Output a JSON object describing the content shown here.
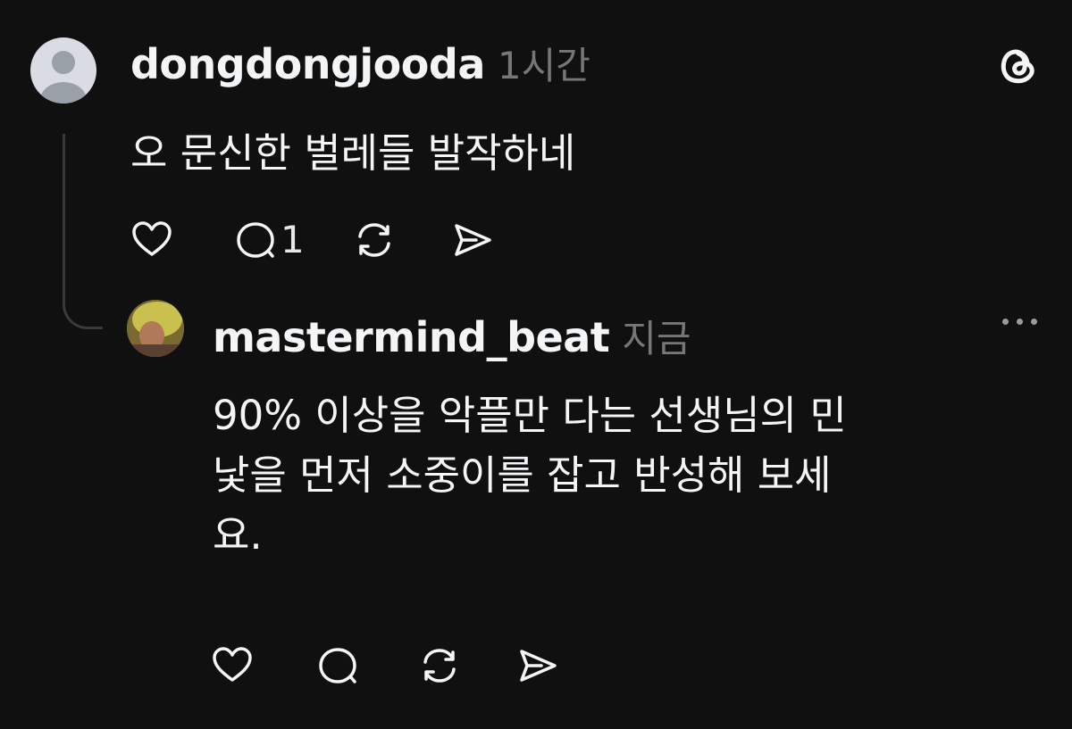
{
  "comment": {
    "username": "dongdongjooda",
    "time": "1시간",
    "text": "오 문신한 벌레들 발작하네",
    "reply_count": "1"
  },
  "reply": {
    "username": "mastermind_beat",
    "time": "지금",
    "lines": [
      "90% 이상을 악플만 다는 선생님의 민",
      "낯을 먼저 소중이를 잡고 반성해 보세",
      "요."
    ]
  },
  "icons": {
    "app_logo": "threads-logo-icon",
    "like": "heart-icon",
    "comment": "comment-bubble-icon",
    "repost": "repost-icon",
    "share": "send-icon",
    "more": "more-icon"
  },
  "colors": {
    "background": "#101010",
    "text": "#f3f5f7",
    "muted": "#777777",
    "thread_line": "#3a3a3a"
  }
}
